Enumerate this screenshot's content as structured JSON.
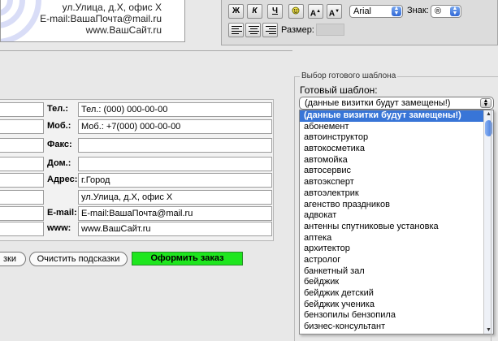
{
  "card": {
    "lines": [
      "ул.Улица, д.Х, офис Х",
      "E-mail:ВашаПочта@mail.ru",
      "www.ВашСайт.ru"
    ]
  },
  "toolbar": {
    "bold": "Ж",
    "italic": "К",
    "underline": "Ч",
    "shadow_icon": "sun-shadow-icon",
    "grow": "A",
    "shrink": "A",
    "font_value": "Arial",
    "sign_label": "Знак:",
    "sign_value": "®",
    "size_label": "Размер:",
    "size_value": ""
  },
  "form": {
    "rows": [
      {
        "label": "Тел.:",
        "value": "Тел.: (000) 000-00-00",
        "left_value": ""
      },
      {
        "label": "Моб.:",
        "value": "Моб.: +7(000) 000-00-00",
        "left_value": ""
      },
      {
        "label": "Факс:",
        "value": "",
        "left_value": ""
      },
      {
        "label": "Дом.:",
        "value": "",
        "left_value": ""
      },
      {
        "label": "Адрес:",
        "value": "г.Город",
        "left_value": ""
      },
      {
        "label": "",
        "value": "ул.Улица, д.Х, офис Х",
        "left_value": ""
      },
      {
        "label": "E-mail:",
        "value": "E-mail:ВашаПочта@mail.ru",
        "left_value": ""
      },
      {
        "label": "www:",
        "value": "www.ВашСайт.ru",
        "left_value": ""
      }
    ]
  },
  "buttons": {
    "hints_partial": "зки",
    "clear_hints": "Очистить подсказки",
    "order": "Оформить заказ"
  },
  "template": {
    "legend": "Выбор готового шаблона",
    "label": "Готовый шаблон:",
    "selected": "(данные визитки будут замещены!)",
    "options": [
      "(данные визитки будут замещены!)",
      "абонемент",
      "автоинструктор",
      "автокосметика",
      "автомойка",
      "автосервис",
      "автоэксперт",
      "автоэлектрик",
      "агенство праздников",
      "адвокат",
      "антенны спутниковые установка",
      "аптека",
      "архитектор",
      "астролог",
      "банкетный зал",
      "бейджик",
      "бейджик детский",
      "бейджик ученика",
      "бензопилы бензопила",
      "бизнес-консультант"
    ]
  },
  "colors": {
    "order_button": "#1ee61e",
    "selection": "#3875d7",
    "swirl": "#d9ddf7"
  }
}
